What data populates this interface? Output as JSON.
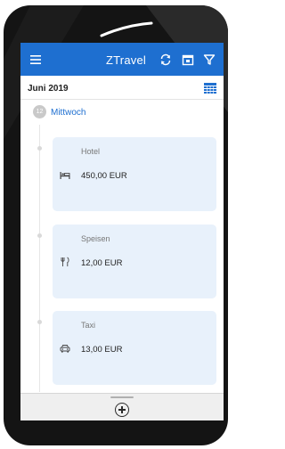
{
  "app": {
    "title": "ZTravel"
  },
  "toolbar": {
    "menu_icon": "hamburger-menu-icon",
    "refresh_icon": "refresh-icon",
    "calendar_icon": "calendar-icon",
    "filter_icon": "filter-icon"
  },
  "month": {
    "label": "Juni 2019",
    "calendar_grid_icon": "calendar-grid-icon"
  },
  "day": {
    "number": "12",
    "label": "Mittwoch"
  },
  "expenses": [
    {
      "category": "Hotel",
      "amount": "450,00 EUR",
      "icon": "hotel-bed-icon"
    },
    {
      "category": "Speisen",
      "amount": "12,00 EUR",
      "icon": "fork-knife-icon"
    },
    {
      "category": "Taxi",
      "amount": "13,00 EUR",
      "icon": "car-icon"
    }
  ],
  "bottom": {
    "add_icon": "add-circle-icon"
  },
  "colors": {
    "accent": "#1e6fd0",
    "card": "#e8f1fb",
    "frame": "#141414"
  }
}
